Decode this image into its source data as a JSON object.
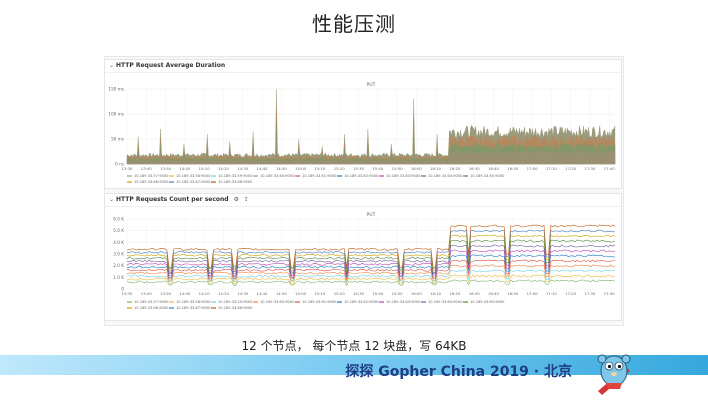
{
  "slide": {
    "title": "性能压测",
    "caption": "12 个节点， 每个节点 12 块盘，写 64KB",
    "banner": "探探 Gopher China 2019 · 北京",
    "colors": {
      "banner_text": "#1f3e84",
      "banner_light": "#bfe8fb",
      "banner_dark": "#36a8dd"
    },
    "icons": {
      "collapse": "chevron-down-icon",
      "mascot": "gopher-mascot-icon",
      "info": "info-icon",
      "share": "share-icon"
    }
  },
  "panel1": {
    "title": "HTTP Request Average Duration",
    "chart_title": "PUT",
    "y_ticks": [
      "150 ms",
      "100 ms",
      "50 ms",
      "0 ns"
    ],
    "legend": [
      "10.189.33.57:9000",
      "10.189.33.58:9000",
      "10.189.33.59:9000",
      "10.189.33.60:9000",
      "10.189.33.61:9000",
      "10.189.33.62:9000",
      "10.189.33.63:9000",
      "10.189.33.64:9000",
      "10.189.33.65:9000",
      "10.189.33.66:9000",
      "10.189.33.67:9000",
      "10.189.33.68:9000"
    ]
  },
  "panel2": {
    "title": "HTTP Requests Count per second",
    "chart_title": "PUT",
    "y_ticks": [
      "6.0 K",
      "5.0 K",
      "4.0 K",
      "3.0 K",
      "2.0 K",
      "1.0 K",
      "0"
    ],
    "legend": [
      "10.189.33.57:9000",
      "10.189.33.58:9000",
      "10.189.33.59:9000",
      "10.189.33.60:9000",
      "10.189.33.61:9000",
      "10.189.33.62:9000",
      "10.189.33.63:9000",
      "10.189.33.64:9000",
      "10.189.33.65:9000",
      "10.189.33.66:9000",
      "10.189.33.67:9000",
      "10.189.33.68:9000"
    ]
  },
  "x_ticks": [
    "13:30",
    "13:40",
    "13:50",
    "14:00",
    "14:10",
    "14:20",
    "14:30",
    "14:40",
    "14:50",
    "15:00",
    "15:10",
    "15:20",
    "15:30",
    "15:40",
    "15:50",
    "16:00",
    "16:10",
    "16:20",
    "16:30",
    "16:40",
    "16:50",
    "17:00",
    "17:10",
    "17:20",
    "17:30",
    "17:40"
  ],
  "series_colors": [
    "#7eb26d",
    "#eab839",
    "#6ed0e0",
    "#ef843c",
    "#e24d42",
    "#1f78c1",
    "#ba43a9",
    "#705da0",
    "#508642",
    "#cca300",
    "#447ebc",
    "#c15c17"
  ],
  "chart_data": [
    {
      "type": "area",
      "title": "HTTP Request Average Duration",
      "subtitle": "PUT",
      "x_range": [
        "13:30",
        "17:45"
      ],
      "y_range_ms": [
        0,
        150
      ],
      "series_count": 12,
      "summary": {
        "phase1": {
          "from": "13:30",
          "to": "16:20",
          "baseline_ms": 18,
          "spikes_ms": [
            55,
            70,
            40,
            60,
            45,
            65,
            150,
            50,
            35,
            60,
            70,
            40,
            130,
            60
          ]
        },
        "phase2": {
          "from": "16:20",
          "to": "17:45",
          "baseline_ms": 65,
          "range_ms": [
            55,
            80
          ]
        }
      }
    },
    {
      "type": "line",
      "title": "HTTP Requests Count per second",
      "subtitle": "PUT",
      "x_range": [
        "13:30",
        "17:45"
      ],
      "y_range": [
        0,
        6000
      ],
      "series_count": 12,
      "summary": {
        "phase1": {
          "from": "13:30",
          "to": "16:20",
          "series_range": [
            600,
            3400
          ]
        },
        "phase2": {
          "from": "16:20",
          "to": "17:45",
          "series_range": [
            700,
            5400
          ]
        }
      }
    }
  ]
}
